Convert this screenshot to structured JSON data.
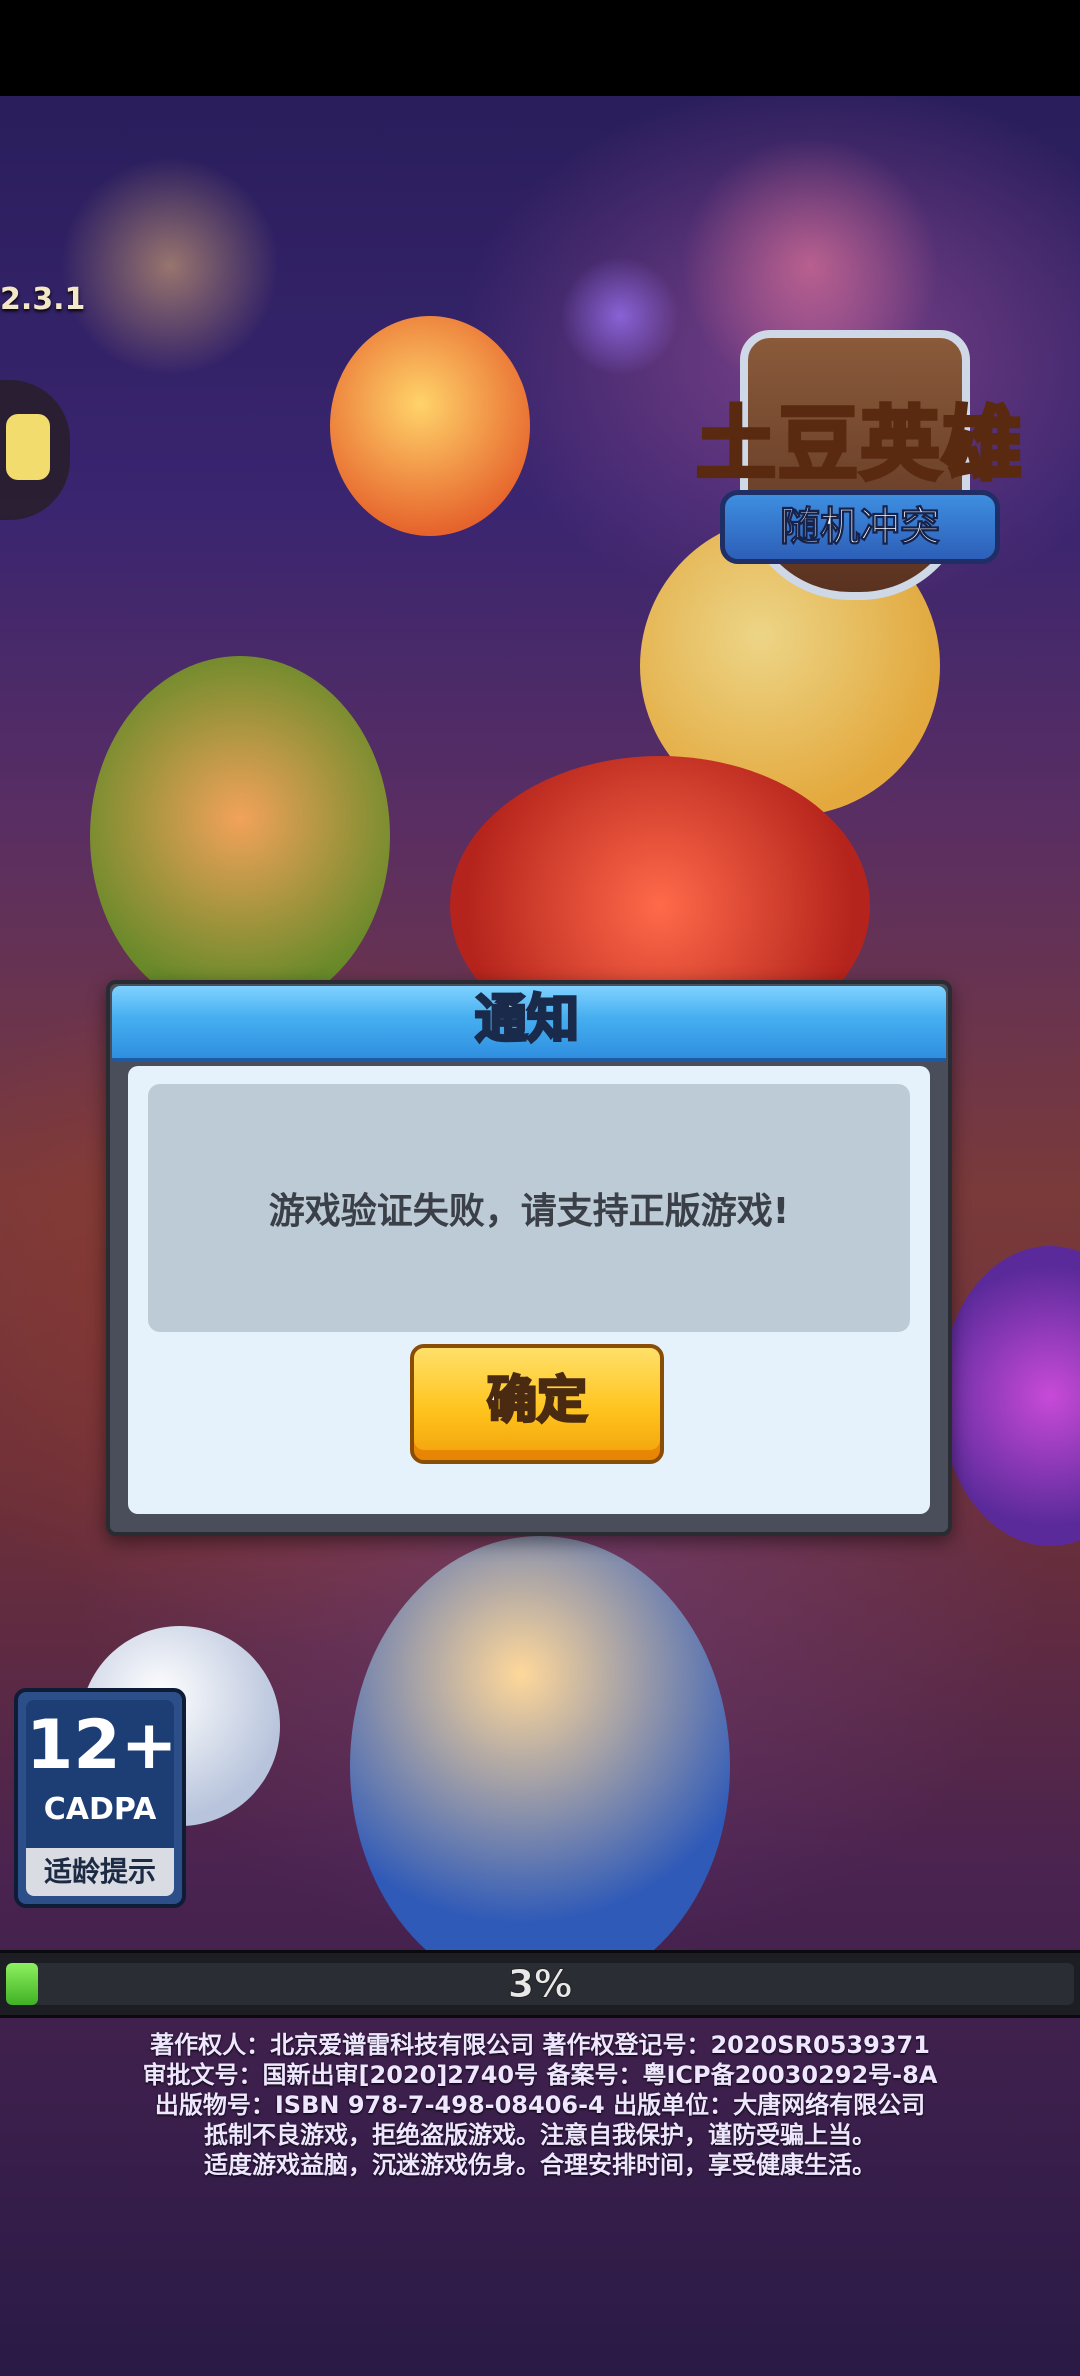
{
  "game": {
    "version": "2.3.1",
    "logo_title": "土豆英雄",
    "logo_subtitle": "随机冲突"
  },
  "dialog": {
    "title": "通知",
    "message": "游戏验证失败，请支持正版游戏!",
    "confirm_label": "确定"
  },
  "age_rating": {
    "number": "12+",
    "org": "CADPA",
    "tip": "适龄提示"
  },
  "loading": {
    "percent": 3,
    "percent_label": "3%"
  },
  "legal": {
    "line1": "著作权人：北京爱谱雷科技有限公司 著作权登记号：2020SR0539371",
    "line2": "审批文号：国新出审[2020]2740号 备案号：粤ICP备20030292号-8A",
    "line3": "出版物号：ISBN 978-7-498-08406-4 出版单位：大唐网络有限公司",
    "line4": "抵制不良游戏，拒绝盗版游戏。注意自我保护，谨防受骗上当。",
    "line5": "适度游戏益脑，沉迷游戏伤身。合理安排时间，享受健康生活。"
  },
  "colors": {
    "dialog_header": "#45aef0",
    "confirm_button": "#ffc41e",
    "progress_fill": "#3fb124"
  }
}
